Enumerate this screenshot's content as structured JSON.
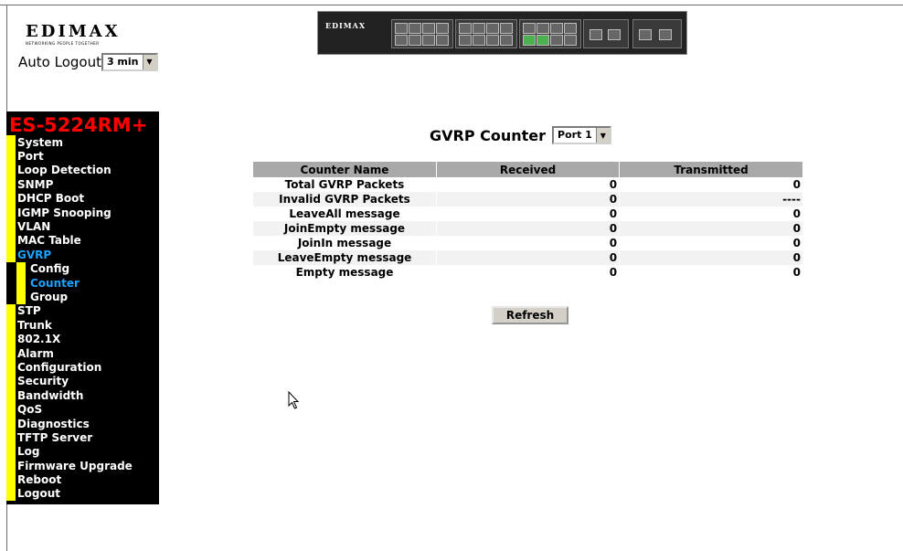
{
  "logo": {
    "word": "EDIMAX",
    "tagline": "NETWORKING PEOPLE TOGETHER"
  },
  "auto_logout": {
    "label": "Auto Logout",
    "value": "3 min"
  },
  "device_image": {
    "brand": "EDIMAX"
  },
  "sidebar": {
    "title": "ES-5224RM+",
    "items": [
      {
        "label": "System",
        "sub": false,
        "active": false
      },
      {
        "label": "Port",
        "sub": false,
        "active": false
      },
      {
        "label": "Loop Detection",
        "sub": false,
        "active": false
      },
      {
        "label": "SNMP",
        "sub": false,
        "active": false
      },
      {
        "label": "DHCP Boot",
        "sub": false,
        "active": false
      },
      {
        "label": "IGMP Snooping",
        "sub": false,
        "active": false
      },
      {
        "label": "VLAN",
        "sub": false,
        "active": false
      },
      {
        "label": "MAC Table",
        "sub": false,
        "active": false
      },
      {
        "label": "GVRP",
        "sub": false,
        "active": true
      },
      {
        "label": "Config",
        "sub": true,
        "active": false
      },
      {
        "label": "Counter",
        "sub": true,
        "active": true
      },
      {
        "label": "Group",
        "sub": true,
        "active": false
      },
      {
        "label": "STP",
        "sub": false,
        "active": false
      },
      {
        "label": "Trunk",
        "sub": false,
        "active": false
      },
      {
        "label": "802.1X",
        "sub": false,
        "active": false
      },
      {
        "label": "Alarm",
        "sub": false,
        "active": false
      },
      {
        "label": "Configuration",
        "sub": false,
        "active": false
      },
      {
        "label": "Security",
        "sub": false,
        "active": false
      },
      {
        "label": "Bandwidth",
        "sub": false,
        "active": false
      },
      {
        "label": "QoS",
        "sub": false,
        "active": false
      },
      {
        "label": "Diagnostics",
        "sub": false,
        "active": false
      },
      {
        "label": "TFTP Server",
        "sub": false,
        "active": false
      },
      {
        "label": "Log",
        "sub": false,
        "active": false
      },
      {
        "label": "Firmware Upgrade",
        "sub": false,
        "active": false
      },
      {
        "label": "Reboot",
        "sub": false,
        "active": false
      },
      {
        "label": "Logout",
        "sub": false,
        "active": false
      }
    ]
  },
  "main": {
    "title": "GVRP Counter",
    "port_select": "Port 1",
    "columns": [
      "Counter Name",
      "Received",
      "Transmitted"
    ],
    "rows": [
      {
        "name": "Total GVRP Packets",
        "received": "0",
        "transmitted": "0"
      },
      {
        "name": "Invalid GVRP Packets",
        "received": "0",
        "transmitted": "----"
      },
      {
        "name": "LeaveAll message",
        "received": "0",
        "transmitted": "0"
      },
      {
        "name": "JoinEmpty message",
        "received": "0",
        "transmitted": "0"
      },
      {
        "name": "JoinIn message",
        "received": "0",
        "transmitted": "0"
      },
      {
        "name": "LeaveEmpty message",
        "received": "0",
        "transmitted": "0"
      },
      {
        "name": "Empty message",
        "received": "0",
        "transmitted": "0"
      }
    ],
    "refresh_label": "Refresh"
  },
  "colors": {
    "sidebar_bg": "#000000",
    "sidebar_title": "#ff0000",
    "sidebar_marker": "#ffff00",
    "active_link": "#1aa3ff",
    "table_header": "#a9a9a9"
  },
  "icons": {
    "dropdown": "chevron-down-icon",
    "cursor": "mouse-pointer-icon"
  }
}
